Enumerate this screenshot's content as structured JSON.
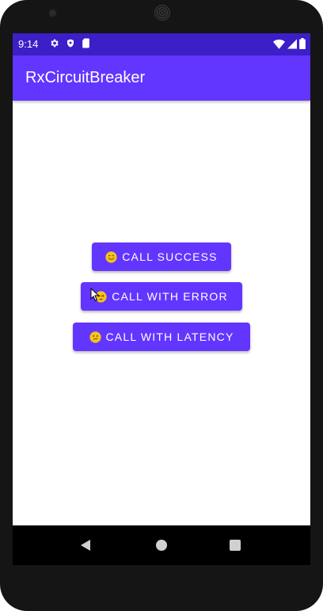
{
  "status_bar": {
    "time": "9:14",
    "icons": [
      "gear-icon",
      "shield-icon",
      "sim-card-icon",
      "wifi-icon",
      "signal-icon",
      "battery-icon"
    ],
    "color": "#3d1fc8"
  },
  "app_bar": {
    "title": "RxCircuitBreaker",
    "color": "#6236ff"
  },
  "buttons": [
    {
      "label": "CALL SUCCESS",
      "emoji": "smiling-face-icon"
    },
    {
      "label": "CALL WITH ERROR",
      "emoji": "tired-face-icon"
    },
    {
      "label": "CALL WITH LATENCY",
      "emoji": "confused-face-icon"
    }
  ],
  "navigation": {
    "items": [
      "back-icon",
      "home-icon",
      "recents-icon"
    ]
  }
}
